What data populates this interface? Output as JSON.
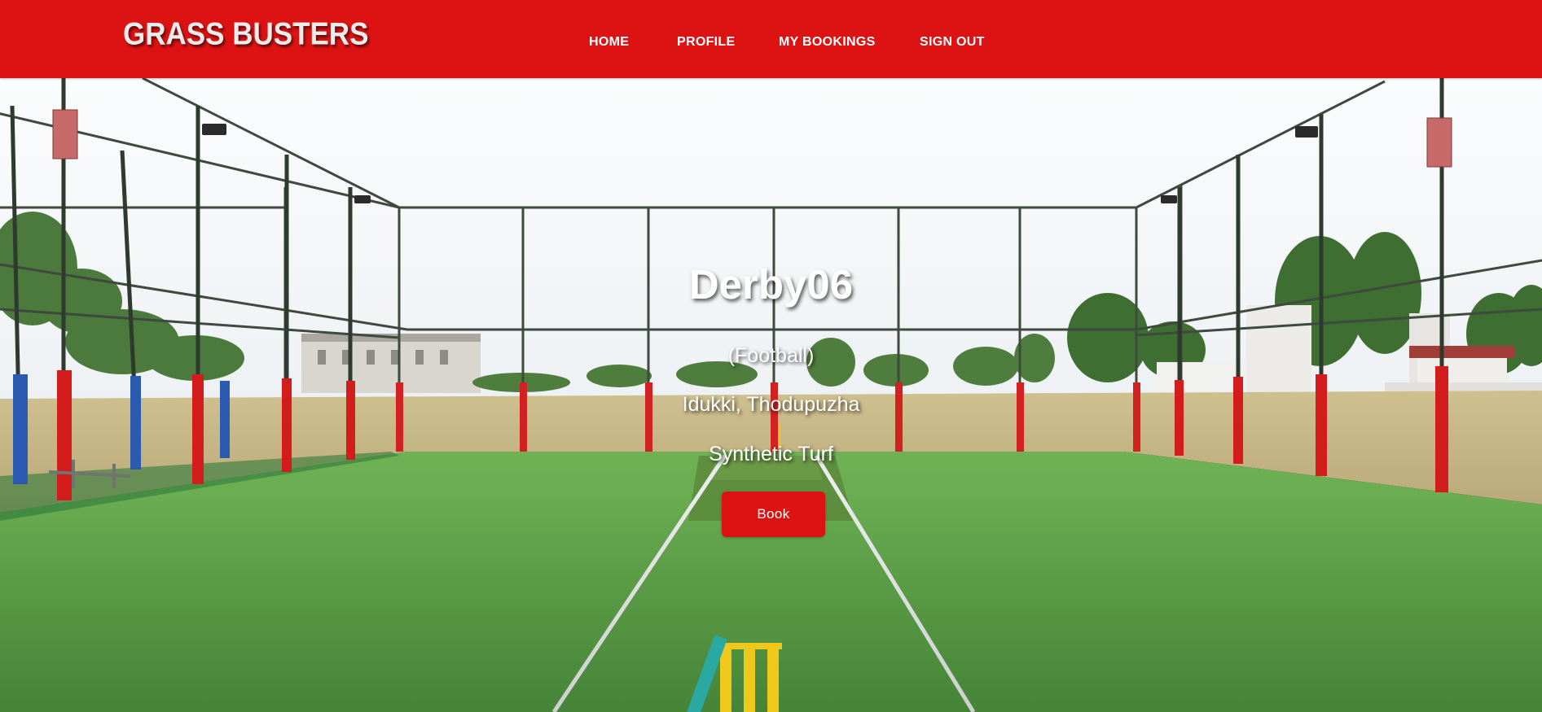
{
  "header": {
    "brand": "GRASS BUSTERS",
    "nav": [
      {
        "label": "HOME"
      },
      {
        "label": "PROFILE"
      },
      {
        "label": "MY BOOKINGS"
      },
      {
        "label": "SIGN OUT"
      }
    ],
    "background_color": "#dd1313"
  },
  "hero": {
    "venue_name": "Derby06",
    "sport": "(Football)",
    "location": "Idukki, Thodupuzha",
    "surface": "Synthetic Turf",
    "book_label": "Book",
    "book_button_color": "#dd1313"
  }
}
